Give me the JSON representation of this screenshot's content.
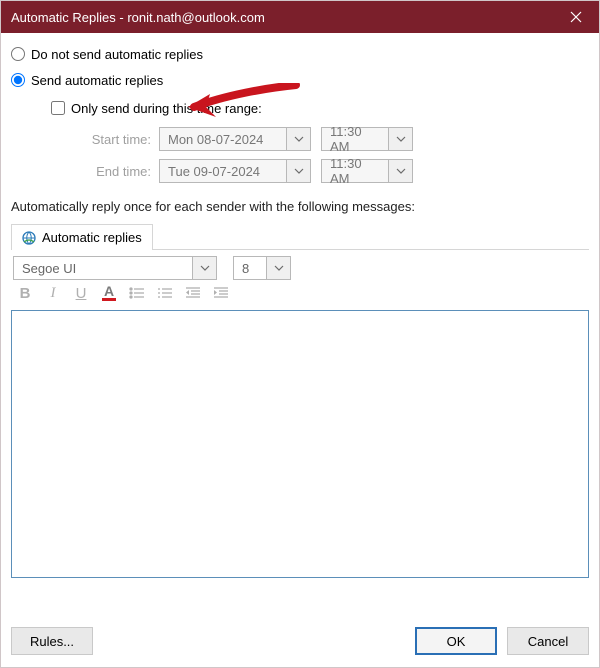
{
  "title": "Automatic Replies - ronit.nath@outlook.com",
  "radios": {
    "do_not_send": "Do not send automatic replies",
    "send": "Send automatic replies"
  },
  "checkbox": {
    "only_range": "Only send during this time range:"
  },
  "time": {
    "start_label": "Start time:",
    "start_date": "Mon 08-07-2024",
    "start_time": "11:30 AM",
    "end_label": "End time:",
    "end_date": "Tue 09-07-2024",
    "end_time": "11:30 AM"
  },
  "instruction": "Automatically reply once for each sender with the following messages:",
  "tab": {
    "auto_replies": "Automatic replies"
  },
  "editor": {
    "font_name": "Segoe UI",
    "font_size": "8",
    "bold": "B",
    "italic": "I",
    "underline": "U",
    "fontcolor_letter": "A"
  },
  "buttons": {
    "rules": "Rules...",
    "ok": "OK",
    "cancel": "Cancel"
  }
}
